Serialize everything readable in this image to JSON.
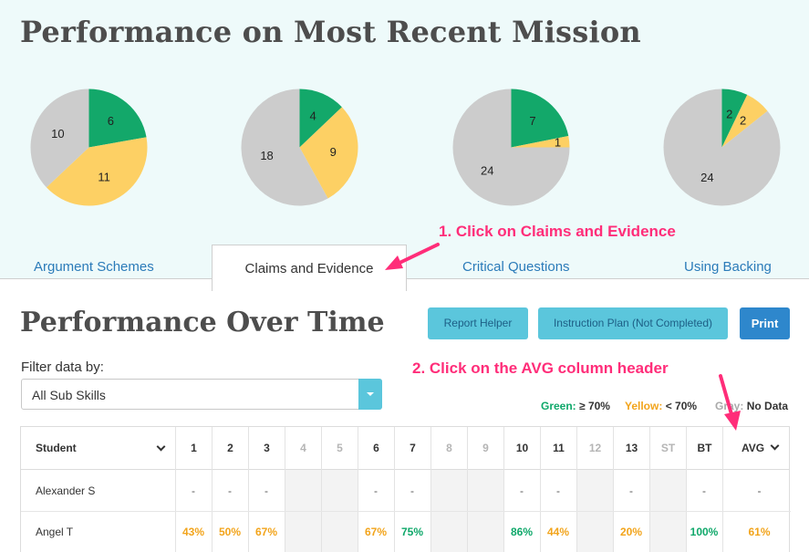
{
  "top": {
    "title": "Performance on Most Recent Mission",
    "pies": [
      {
        "green": 6,
        "yellow": 11,
        "gray": 10
      },
      {
        "green": 4,
        "yellow": 9,
        "gray": 18
      },
      {
        "green": 7,
        "yellow": 1,
        "gray": 24
      },
      {
        "green": 2,
        "yellow": 2,
        "gray": 24
      }
    ],
    "colors": {
      "green": "#13a86a",
      "yellow": "#fdd064",
      "gray": "#cccccc"
    }
  },
  "tabs": [
    "Argument Schemes",
    "Claims and Evidence",
    "Critical Questions",
    "Using Backing"
  ],
  "active_tab": 1,
  "callouts": {
    "step1": "1. Click on Claims and Evidence",
    "step2": "2. Click on the AVG column header"
  },
  "section": {
    "title": "Performance Over Time",
    "buttons": {
      "report_helper": "Report Helper",
      "instruction_plan": "Instruction Plan (Not Completed)",
      "print": "Print"
    },
    "filter_label": "Filter data by:",
    "filter_value": "All Sub Skills",
    "legend": {
      "green_label": "Green:",
      "green_value": "≥ 70%",
      "yellow_label": "Yellow:",
      "yellow_value": "< 70%",
      "gray_label": "Gray:",
      "gray_value": "No Data"
    }
  },
  "table": {
    "headers": [
      "Student",
      "1",
      "2",
      "3",
      "4",
      "5",
      "6",
      "7",
      "8",
      "9",
      "10",
      "11",
      "12",
      "13",
      "ST",
      "BT",
      "AVG"
    ],
    "dim_columns": [
      4,
      5,
      8,
      9,
      12,
      14
    ],
    "rows": [
      {
        "name": "Alexander S",
        "values": [
          "-",
          "-",
          "-",
          "",
          "",
          "-",
          "-",
          "",
          "",
          "-",
          "-",
          "",
          "-",
          "",
          "-",
          "-"
        ]
      },
      {
        "name": "Angel T",
        "values": [
          "43%",
          "50%",
          "67%",
          "",
          "",
          "67%",
          "75%",
          "",
          "",
          "86%",
          "44%",
          "",
          "20%",
          "",
          "100%",
          "61%"
        ]
      }
    ]
  }
}
